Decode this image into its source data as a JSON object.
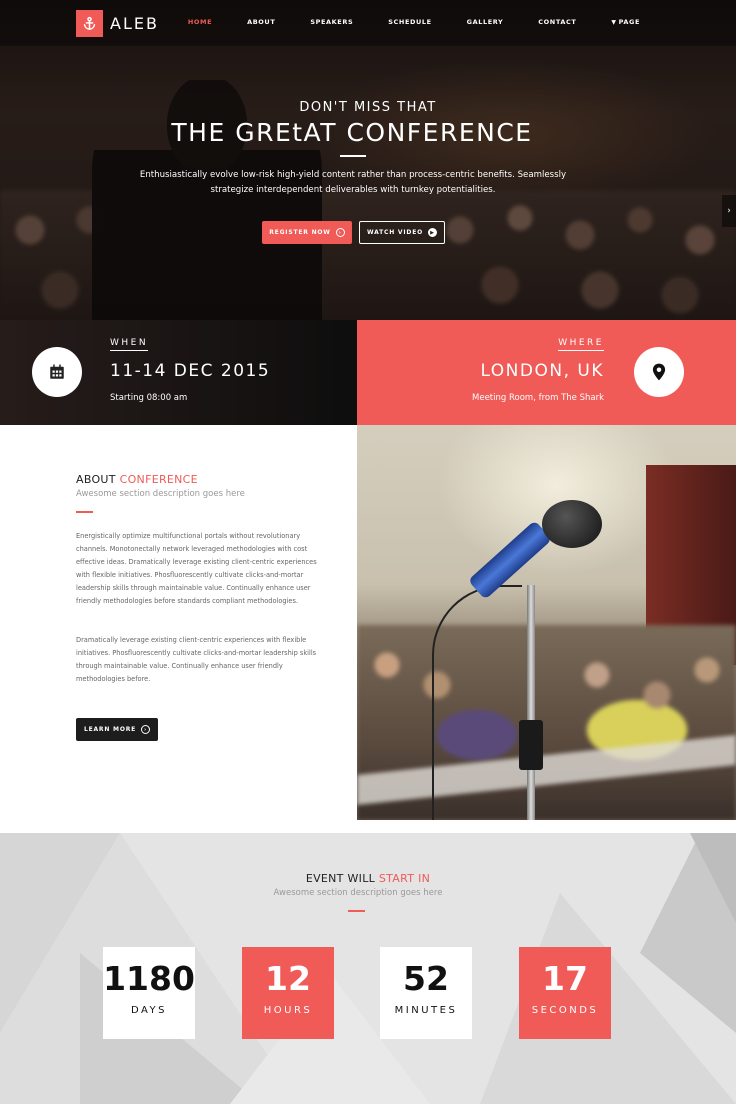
{
  "brand": {
    "name": "ALEB",
    "logo_icon": "anchor-icon",
    "accent": "#f05a57"
  },
  "nav": {
    "items": [
      {
        "label": "HOME",
        "active": true
      },
      {
        "label": "ABOUT"
      },
      {
        "label": "SPEAKERS"
      },
      {
        "label": "SCHEDULE"
      },
      {
        "label": "GALLERY"
      },
      {
        "label": "CONTACT"
      },
      {
        "label": "PAGE",
        "icon": "caret-down-icon"
      }
    ]
  },
  "hero": {
    "eyebrow": "DON'T MISS THAT",
    "title": "THE GREtAT CONFERENCE",
    "description": "Enthusiastically evolve low-risk high-yield content rather than process-centric benefits. Seamlessly strategize interdependent deliverables with turnkey potentialities.",
    "register_label": "REGISTER NOW",
    "watch_label": "WATCH VIDEO"
  },
  "when": {
    "label": "WHEN",
    "date": "11-14 DEC 2015",
    "sub": "Starting 08:00 am",
    "icon": "calendar-icon"
  },
  "where": {
    "label": "WHERE",
    "place": "LONDON, UK",
    "sub": "Meeting Room, from The Shark",
    "icon": "map-pin-icon"
  },
  "about": {
    "title_prefix": "ABOUT",
    "title_accent": "CONFERENCE",
    "description": "Awesome section description goes here",
    "paragraph1": "Energistically optimize multifunctional portals without revolutionary channels. Monotonectally network leveraged methodologies with cost effective ideas. Dramatically leverage existing client-centric experiences with flexible initiatives. Phosfluorescently cultivate clicks-and-mortar leadership skills through maintainable value. Continually enhance user friendly methodologies before standards compliant methodologies.",
    "paragraph2": "Dramatically leverage existing client-centric experiences with flexible initiatives. Phosfluorescently cultivate clicks-and-mortar leadership skills through maintainable value. Continually enhance user friendly methodologies before.",
    "button_label": "LEARN MORE"
  },
  "countdown": {
    "title_prefix": "EVENT WILL",
    "title_accent": "START IN",
    "description": "Awesome section description goes here",
    "days": {
      "value": "1180",
      "label": "DAYS"
    },
    "hours": {
      "value": "12",
      "label": "HOURS"
    },
    "minutes": {
      "value": "52",
      "label": "MINUTES"
    },
    "seconds": {
      "value": "17",
      "label": "SECONDS"
    }
  }
}
